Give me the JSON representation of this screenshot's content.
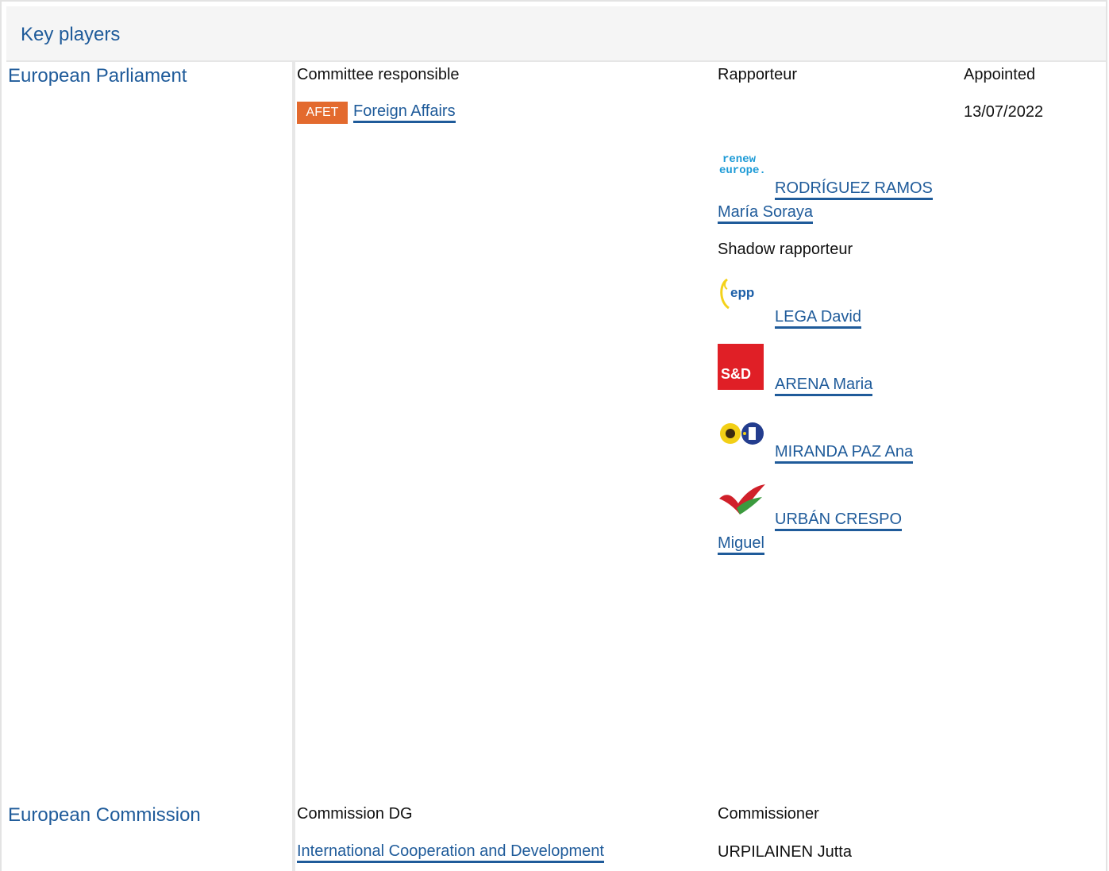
{
  "header": {
    "title": "Key players"
  },
  "parliament": {
    "institution": "European Parliament",
    "columns": {
      "committee_responsible": "Committee responsible",
      "rapporteur": "Rapporteur",
      "appointed": "Appointed"
    },
    "committee": {
      "code": "AFET",
      "name": "Foreign Affairs",
      "appointed_date": "13/07/2022",
      "badge_color": "#e36a2e"
    },
    "rapporteur": {
      "group_logo_text_1": "renew",
      "group_logo_text_2": "europe.",
      "name_line1": "RODRÍGUEZ RAMOS",
      "name_line2": "María Soraya"
    },
    "shadow_label": "Shadow rapporteur",
    "shadows": [
      {
        "group_logo": "epp",
        "name": "LEGA David"
      },
      {
        "group_logo": "S&D",
        "name": "ARENA Maria"
      },
      {
        "group_logo": "greens-efa-icon",
        "name": "MIRANDA PAZ Ana"
      },
      {
        "group_logo": "the-left-icon",
        "name_line1": "URBÁN CRESPO",
        "name_line2": "Miguel"
      }
    ]
  },
  "commission": {
    "institution": "European Commission",
    "columns": {
      "dg": "Commission DG",
      "commissioner": "Commissioner"
    },
    "dg_name": "International Cooperation and Development",
    "commissioner_name": "URPILAINEN Jutta"
  },
  "colors": {
    "link": "#1f5b9a",
    "header_bg": "#f5f5f5"
  }
}
